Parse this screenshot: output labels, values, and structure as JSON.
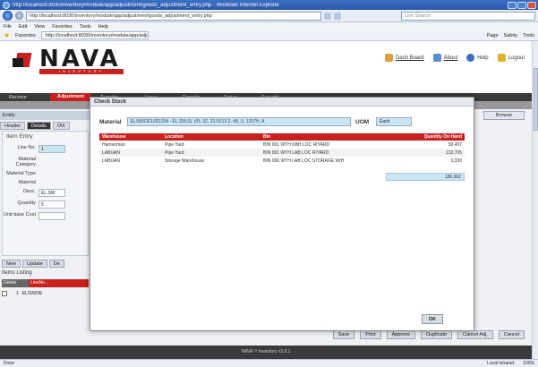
{
  "browser": {
    "title": "http://localhost:8030/inventory/module/app/adjustment/goods_adjustment_entry.php - Windows Internet Explorer",
    "url": "http://localhost:8030/inventory/module/app/adjustment/goods_adjustment_entry.php",
    "search_placeholder": "Live Search",
    "menu": [
      "File",
      "Edit",
      "View",
      "Favorites",
      "Tools",
      "Help"
    ],
    "favorites_label": "Favorites",
    "tab_title": "http://localhost:8030/inventory/module/app/adjustm...",
    "command_items": [
      "Page",
      "Safety",
      "Tools"
    ],
    "status_left": "Done",
    "status_zone": "Local intranet",
    "status_zoom": "100%"
  },
  "app": {
    "logo_text": "NAVA",
    "logo_sub": "INVENTORY",
    "top_links": [
      {
        "label": "Dash Board",
        "icon": "dashboard-icon",
        "color": "#d9a23a"
      },
      {
        "label": "About",
        "icon": "about-icon",
        "color": "#5a8fcf"
      },
      {
        "label": "Help",
        "icon": "help-icon",
        "color": "#3b6fc4"
      },
      {
        "label": "Logout",
        "icon": "logout-icon",
        "color": "#e0b030"
      }
    ],
    "nav": [
      "Receive",
      "Adjustment",
      "Transfer",
      "Issue",
      "Reports",
      "Setup",
      "Security"
    ],
    "active_nav": "Adjustment",
    "entity_label": "Entity",
    "browse_label": "Browse",
    "bg_tabs": [
      "Header",
      "Details",
      "Oth"
    ],
    "item_entry_title": "Item Entry",
    "fields": [
      {
        "label": "Line No.",
        "value": "1",
        "style": "blue"
      },
      {
        "label": "Material Category",
        "value": "",
        "style": ""
      },
      {
        "label": "Material Type",
        "value": "",
        "style": ""
      },
      {
        "label": "Material",
        "value": "",
        "style": ""
      },
      {
        "label": "Desc.",
        "value": "EL.SW",
        "style": ""
      },
      {
        "label": "Quantity",
        "value": "5",
        "style": ""
      },
      {
        "label": "Unit base Cost",
        "value": "",
        "style": ""
      }
    ],
    "bg_buttons": [
      "New",
      "Update",
      "De"
    ],
    "items_listing_title": "Items Listing",
    "listing_cols": [
      "Delete",
      "LineNo..."
    ],
    "listing_row": {
      "line": "1",
      "text": "ELSW/DE"
    },
    "bottom_buttons": [
      "Save",
      "Print",
      "Approve",
      "Duplicate",
      "Cancel Adj.",
      "Cancel"
    ],
    "footer": "NAVA™ Inventory v3.0.1",
    "accent_red": "#c8201d",
    "dark_nav": "#3a3a3a"
  },
  "modal": {
    "title": "Check Stock",
    "material_label": "Material",
    "material_value": "ELSW/DE10D1SW - EL.SW.SL VR, 32, 12.0X13.2, 48, U, 1207H, A",
    "uom_label": "UOM",
    "uom_value": "Each",
    "columns": [
      "Warehouse",
      "Location",
      "Bin",
      "Quantity On Hand"
    ],
    "rows": [
      [
        "Hamanman",
        "Pipe Yard",
        "BIN 001 WTH KBH LOC RIYARD",
        "50,497"
      ],
      [
        "LABUAN",
        "Pipe Yard",
        "BIN 001 WTH LAB LOC RIYARD",
        "132,705"
      ],
      [
        "LABUAN",
        "Storage Warehouse",
        "BIN 036 WTH LAB LOC STORAGE W/H",
        "3,330"
      ]
    ],
    "total": "186,362",
    "ok_label": "OK"
  }
}
